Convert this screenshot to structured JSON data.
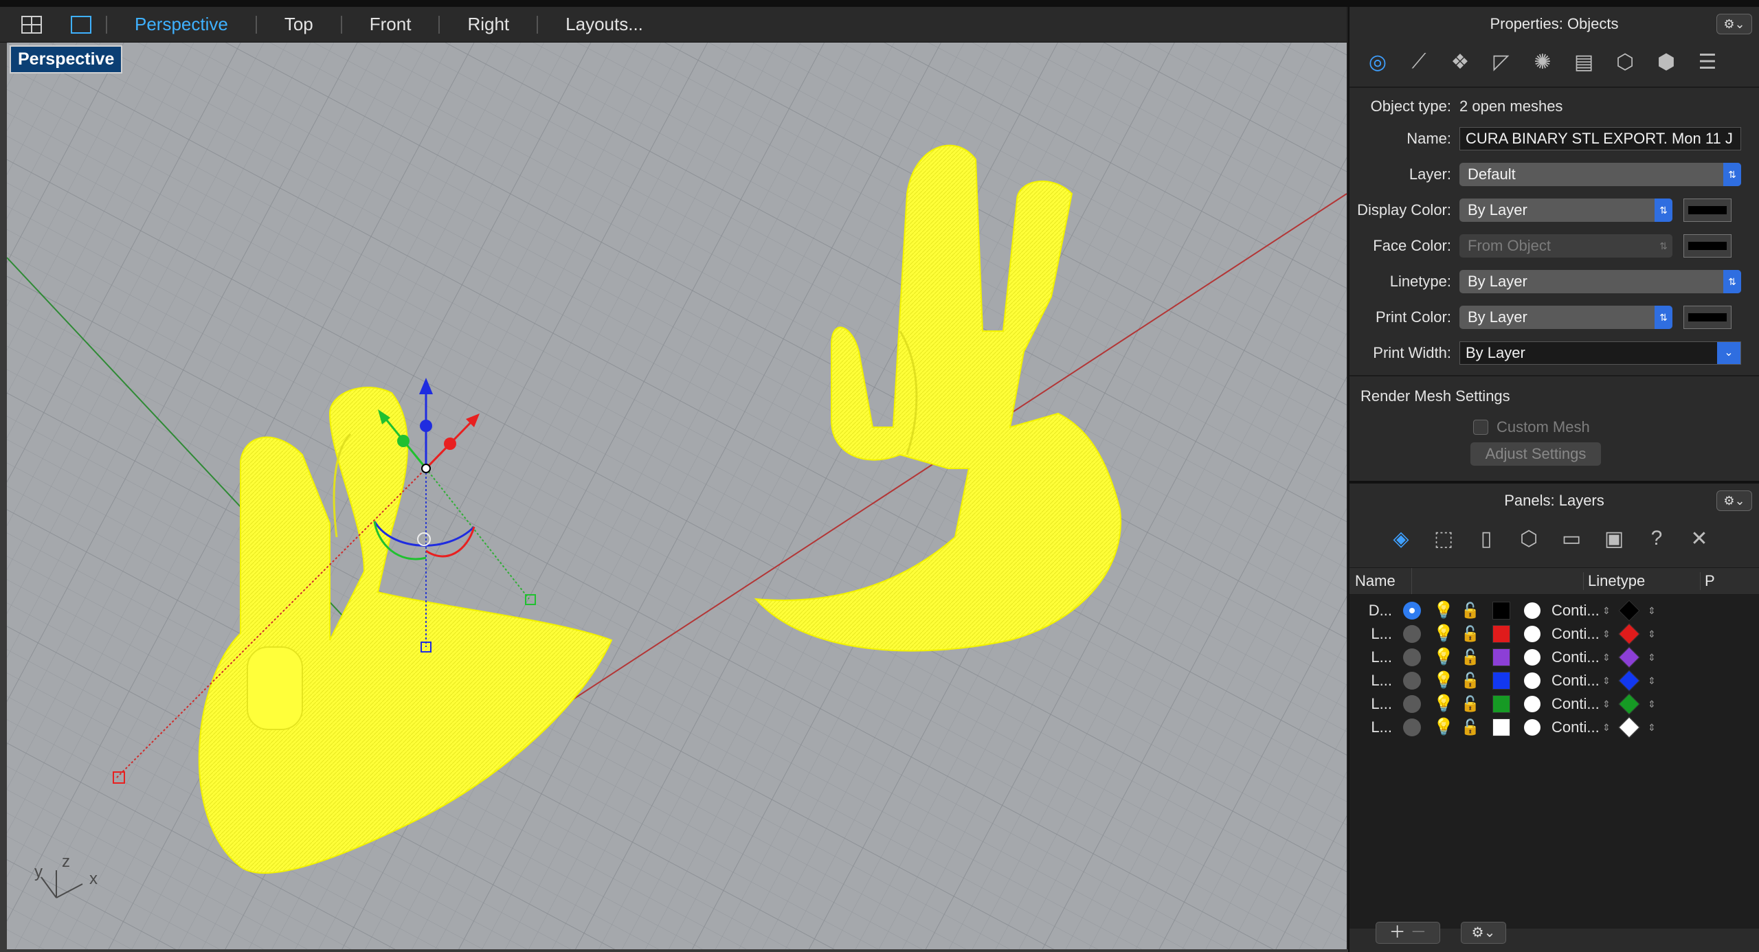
{
  "viewport_bar": {
    "tabs": [
      "Perspective",
      "Top",
      "Front",
      "Right",
      "Layouts..."
    ],
    "active_tab": "Perspective"
  },
  "viewport": {
    "label": "Perspective",
    "axis_labels": {
      "x": "x",
      "y": "y",
      "z": "z"
    }
  },
  "properties": {
    "title": "Properties: Objects",
    "object_type_label": "Object type:",
    "object_type_value": "2 open meshes",
    "name_label": "Name:",
    "name_value": "CURA BINARY STL EXPORT. Mon 11 J",
    "layer_label": "Layer:",
    "layer_value": "Default",
    "display_color_label": "Display Color:",
    "display_color_value": "By Layer",
    "face_color_label": "Face Color:",
    "face_color_value": "From Object",
    "linetype_label": "Linetype:",
    "linetype_value": "By Layer",
    "print_color_label": "Print Color:",
    "print_color_value": "By Layer",
    "print_width_label": "Print Width:",
    "print_width_value": "By Layer",
    "render_mesh_heading": "Render Mesh Settings",
    "custom_mesh_label": "Custom Mesh",
    "adjust_settings_label": "Adjust Settings"
  },
  "layers_panel": {
    "title": "Panels: Layers",
    "col_name": "Name",
    "col_linetype": "Linetype",
    "col_p": "P",
    "rows": [
      {
        "name": "D...",
        "current": true,
        "color": "#000000",
        "linetype": "Conti...",
        "print_color": "#000000"
      },
      {
        "name": "L...",
        "current": false,
        "color": "#e01b1b",
        "linetype": "Conti...",
        "print_color": "#e01b1b"
      },
      {
        "name": "L...",
        "current": false,
        "color": "#8c3fd6",
        "linetype": "Conti...",
        "print_color": "#8c3fd6"
      },
      {
        "name": "L...",
        "current": false,
        "color": "#1238f0",
        "linetype": "Conti...",
        "print_color": "#1238f0"
      },
      {
        "name": "L...",
        "current": false,
        "color": "#169a24",
        "linetype": "Conti...",
        "print_color": "#169a24"
      },
      {
        "name": "L...",
        "current": false,
        "color": "#ffffff",
        "linetype": "Conti...",
        "print_color": "#ffffff"
      }
    ]
  },
  "colors": {
    "accent": "#3fb1ff",
    "mesh_yellow": "#ffff33",
    "viewport_bg": "#a3a6aa"
  }
}
